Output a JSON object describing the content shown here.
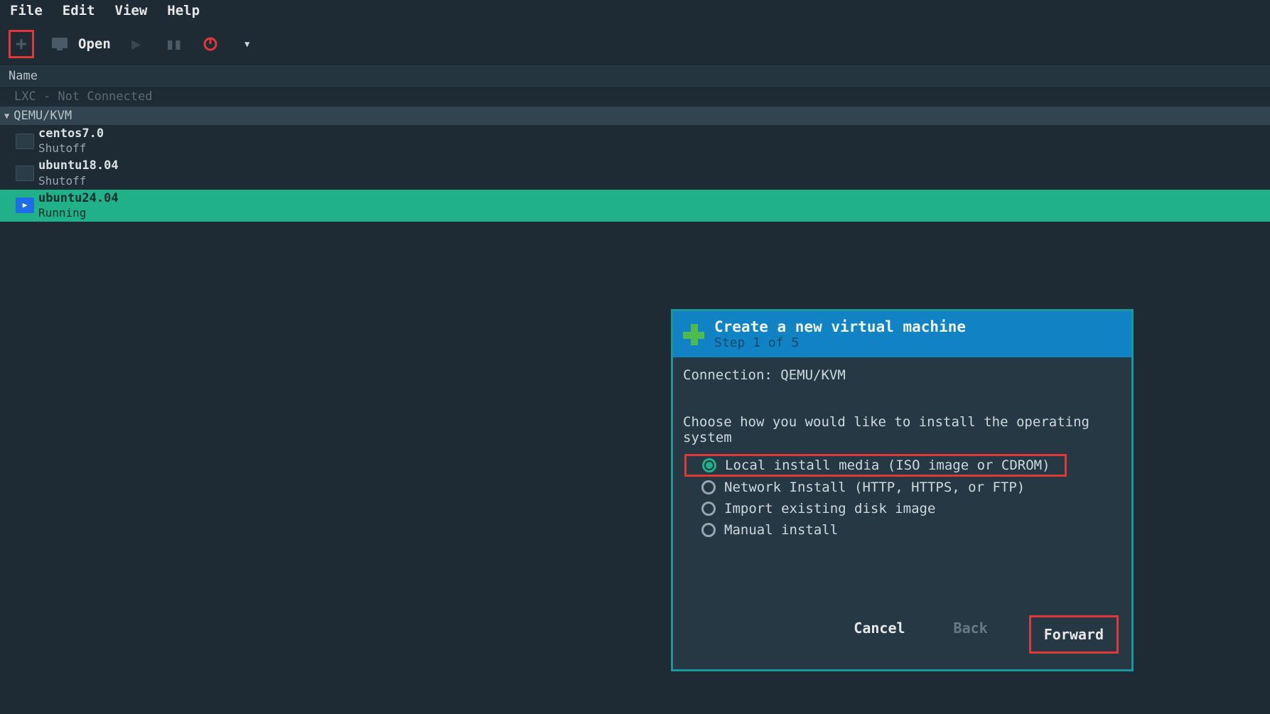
{
  "menubar": {
    "file": "File",
    "edit": "Edit",
    "view": "View",
    "help": "Help"
  },
  "toolbar": {
    "open": "Open"
  },
  "list_header": {
    "name": "Name"
  },
  "tree": {
    "lxc_label": "LXC - Not Connected",
    "group_label": "QEMU/KVM",
    "vms": [
      {
        "name": "centos7.0",
        "status": "Shutoff",
        "running": false,
        "selected": false
      },
      {
        "name": "ubuntu18.04",
        "status": "Shutoff",
        "running": false,
        "selected": false
      },
      {
        "name": "ubuntu24.04",
        "status": "Running",
        "running": true,
        "selected": true
      }
    ]
  },
  "dialog": {
    "title": "Create a new virtual machine",
    "step": "Step 1 of 5",
    "connection": "Connection: QEMU/KVM",
    "choose": "Choose how you would like to install the operating system",
    "options": [
      {
        "label": "Local install media (ISO image or CDROM)",
        "selected": true,
        "highlighted": true
      },
      {
        "label": "Network Install (HTTP, HTTPS, or FTP)",
        "selected": false,
        "highlighted": false
      },
      {
        "label": "Import existing disk image",
        "selected": false,
        "highlighted": false
      },
      {
        "label": "Manual install",
        "selected": false,
        "highlighted": false
      }
    ],
    "buttons": {
      "cancel": "Cancel",
      "back": "Back",
      "forward": "Forward"
    }
  }
}
